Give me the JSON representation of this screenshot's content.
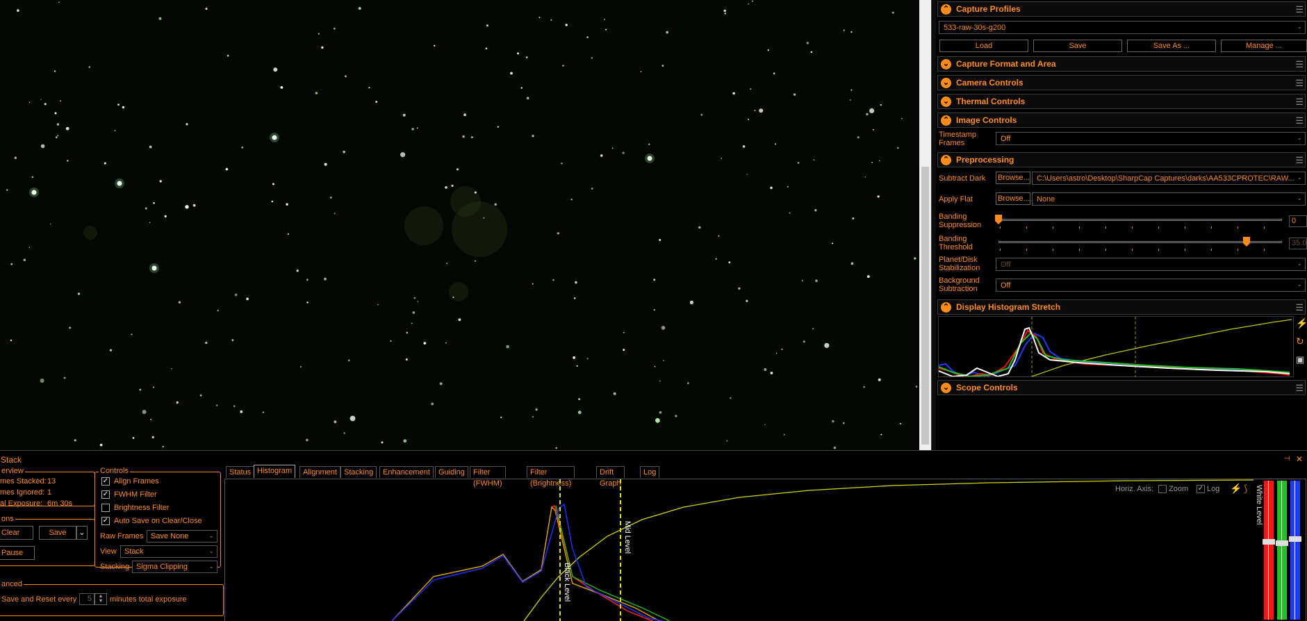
{
  "panel": {
    "capture_profiles": {
      "title": "Capture Profiles",
      "selected": "533-raw-30s-g200",
      "buttons": [
        "Load",
        "Save",
        "Save As ...",
        "Manage ..."
      ]
    },
    "sections": {
      "capture_format": "Capture Format and Area",
      "camera_controls": "Camera Controls",
      "thermal_controls": "Thermal Controls",
      "image_controls": "Image Controls",
      "preprocessing": "Preprocessing",
      "histogram_stretch": "Display Histogram Stretch",
      "scope_controls": "Scope Controls"
    },
    "image_controls": {
      "timestamp_label_1": "Timestamp",
      "timestamp_label_2": "Frames",
      "timestamp_value": "Off"
    },
    "preprocessing": {
      "subtract_dark_label": "Subtract Dark",
      "browse": "Browse...",
      "dark_path": "C:\\Users\\astro\\Desktop\\SharpCap Captures\\darks\\AA533CPROTEC\\RAW...",
      "apply_flat_label": "Apply Flat",
      "flat_value": "None",
      "banding_suppression_1": "Banding",
      "banding_suppression_2": "Suppression",
      "banding_suppression_value": "0",
      "banding_suppression_level": 0.0,
      "banding_threshold_1": "Banding",
      "banding_threshold_2": "Threshold",
      "banding_threshold_value": "35.0",
      "banding_threshold_level": 0.875,
      "planet_1": "Planet/Disk",
      "planet_2": "Stabilization",
      "planet_value": "Off",
      "bg_1": "Background",
      "bg_2": "Subtraction",
      "bg_value": "Off"
    }
  },
  "live_stack": {
    "title": "Stack",
    "overview_title": "erview",
    "frames_stacked_label": "mes Stacked:",
    "frames_stacked": "13",
    "frames_ignored_label": "mes Ignored:",
    "frames_ignored": "1",
    "exposure_label": "al Exposure:",
    "exposure": "6m 30s",
    "actions_title": "ons",
    "clear": "Clear",
    "save": "Save",
    "pause": "Pause",
    "advanced_title": "anced",
    "save_reset_label": "Save and Reset every",
    "save_reset_value": "5",
    "save_reset_suffix": "minutes total exposure",
    "controls_title": "Controls",
    "align_frames": "Align Frames",
    "fwhm_filter": "FWHM Filter",
    "brightness_filter": "Brightness Filter",
    "auto_save": "Auto Save on Clear/Close",
    "raw_frames_label": "Raw Frames",
    "raw_frames_value": "Save None",
    "view_label": "View",
    "view_value": "Stack",
    "stacking_label": "Stacking",
    "stacking_value": "Sigma Clipping",
    "tabs": [
      "Status",
      "Histogram",
      "Alignment",
      "Stacking",
      "Enhancement",
      "Guiding",
      "Filter (FWHM)",
      "Filter (Brightness)",
      "Drift Graph",
      "Log"
    ],
    "active_tab": "Histogram",
    "horiz_axis": "Horiz. Axis:",
    "zoom": "Zoom",
    "log": "Log",
    "black_level": "Black Level",
    "mid_level": "Mid Level",
    "white_level": "White Level"
  },
  "colors": {
    "accent": "#ff8c1a",
    "background": "#000000",
    "curve": "#d8d800"
  },
  "icons": [
    "chevron-up-icon",
    "chevron-down-icon",
    "hamburger-menu-icon",
    "lightning-icon",
    "reset-icon",
    "save-disk-icon",
    "pin-icon",
    "close-icon"
  ]
}
